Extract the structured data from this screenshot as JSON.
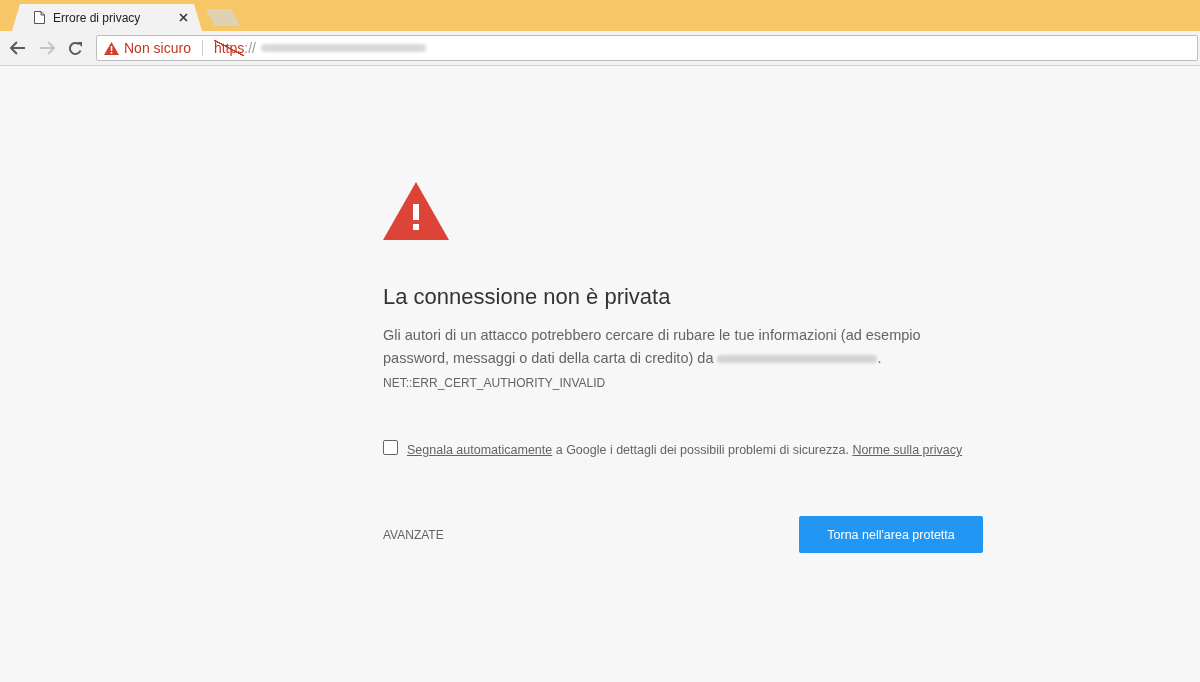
{
  "tabs": [
    {
      "title": "Errore di privacy",
      "selected": true
    }
  ],
  "toolbar": {
    "security_label": "Non sicuro",
    "scheme": "https",
    "separator": "://",
    "back_disabled": false,
    "forward_disabled": true
  },
  "interstitial": {
    "heading": "La connessione non è privata",
    "message_before": "Gli autori di un attacco potrebbero cercare di rubare le tue informazioni (ad esempio password, messaggi o dati della carta di credito) da",
    "message_after": ".",
    "error_code": "NET::ERR_CERT_AUTHORITY_INVALID",
    "report": {
      "checked": false,
      "link_1": "Segnala automaticamente",
      "text": "a Google i dettagli dei possibili problemi di sicurezza.",
      "link_2": "Norme sulla privacy"
    },
    "advanced_button": "AVANZATE",
    "back_button": "Torna nell'area protetta"
  }
}
